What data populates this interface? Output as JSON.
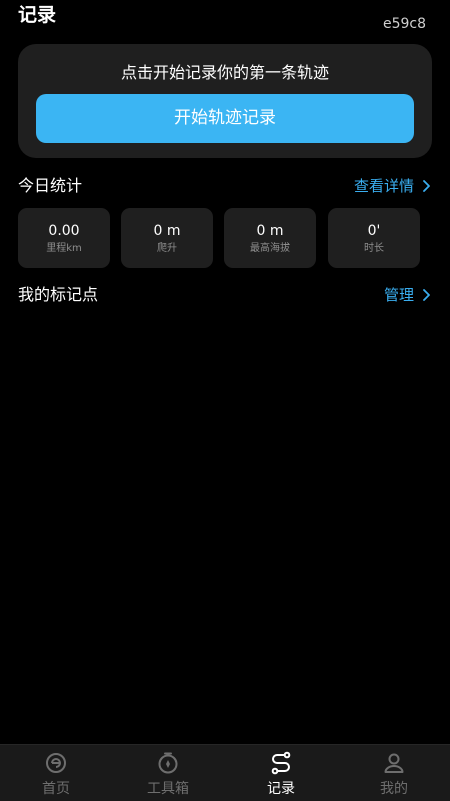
{
  "header": {
    "title": "记录",
    "device_code": "e59c8"
  },
  "start_card": {
    "prompt": "点击开始记录你的第一条轨迹",
    "button_label": "开始轨迹记录"
  },
  "today_stats": {
    "title": "今日统计",
    "link_label": "查看详情",
    "items": [
      {
        "value": "0.00",
        "label": "里程km"
      },
      {
        "value": "0 m",
        "label": "爬升"
      },
      {
        "value": "0 m",
        "label": "最高海拔"
      },
      {
        "value": "0'",
        "label": "时长"
      }
    ]
  },
  "markers": {
    "title": "我的标记点",
    "link_label": "管理"
  },
  "tab_bar": {
    "tabs": [
      {
        "label": "首页",
        "icon": "home-icon",
        "active": false
      },
      {
        "label": "工具箱",
        "icon": "stopwatch-icon",
        "active": false
      },
      {
        "label": "记录",
        "icon": "track-route-icon",
        "active": true
      },
      {
        "label": "我的",
        "icon": "person-icon",
        "active": false
      }
    ]
  },
  "colors": {
    "accent": "#3bb5f3",
    "link": "#3aaef0",
    "card": "#1f1f1f",
    "background": "#000000"
  }
}
